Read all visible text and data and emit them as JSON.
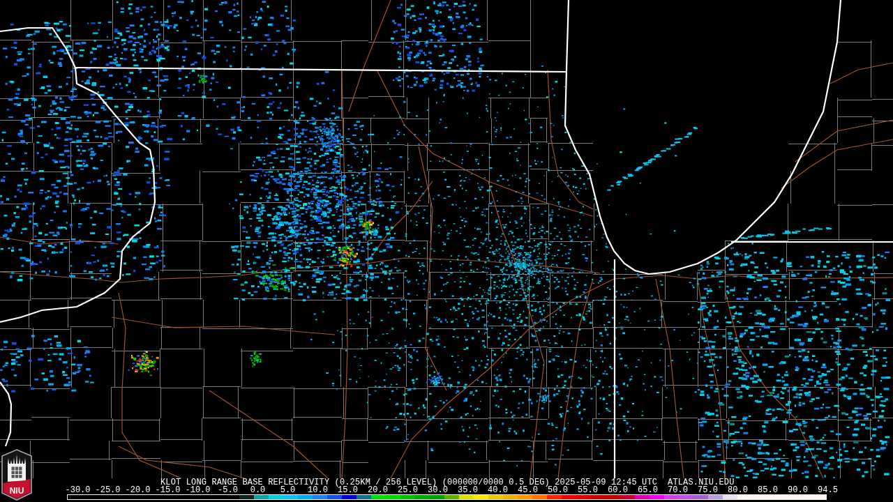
{
  "logo": {
    "text": "NIU"
  },
  "caption": {
    "title": "KLOT LONG RANGE BASE REFLECTIVITY (0.25KM / 256 LEVEL) (000000/0000 0.5 DEG) 2025-05-09 12:45 UTC",
    "source": "ATLAS.NIU.EDU"
  },
  "color_scale": {
    "ticks": [
      "-30.0",
      "-25.0",
      "-20.0",
      "-15.0",
      "-10.0",
      "-5.0",
      "0.0",
      "5.0",
      "10.0",
      "15.0",
      "20.0",
      "25.0",
      "30.0",
      "35.0",
      "40.0",
      "45.0",
      "50.0",
      "55.0",
      "60.0",
      "65.0",
      "70.0",
      "75.0",
      "80.0",
      "85.0",
      "90.0",
      "94.5"
    ],
    "segments": [
      {
        "color": "#0a2222"
      },
      {
        "color": "#10a0a8"
      },
      {
        "color": "#00d0e0"
      },
      {
        "color": "#10c0f0"
      },
      {
        "color": "#00a8f0"
      },
      {
        "color": "#2080f0"
      },
      {
        "color": "#1050e8"
      },
      {
        "color": "#0000d0"
      },
      {
        "color": "#107090"
      },
      {
        "color": "#00e000"
      },
      {
        "color": "#00d800"
      },
      {
        "color": "#00c000"
      },
      {
        "color": "#00a800"
      },
      {
        "color": "#00a000"
      },
      {
        "color": "#60b000"
      },
      {
        "color": "#e0e000"
      },
      {
        "color": "#ffe800"
      },
      {
        "color": "#f0c800"
      },
      {
        "color": "#f0b000"
      },
      {
        "color": "#ff9800"
      },
      {
        "color": "#ff7000"
      },
      {
        "color": "#ff2000"
      },
      {
        "color": "#f00000"
      },
      {
        "color": "#e00000"
      },
      {
        "color": "#c80000"
      },
      {
        "color": "#c00000"
      },
      {
        "color": "#c00030"
      },
      {
        "color": "#e000b0"
      },
      {
        "color": "#f000f0"
      },
      {
        "color": "#d040e8"
      },
      {
        "color": "#c050e0"
      },
      {
        "color": "#a060d0"
      },
      {
        "color": "#b8a0e0"
      },
      {
        "color": "#e8e0f0"
      },
      {
        "color": "#fff8f4"
      }
    ]
  }
}
